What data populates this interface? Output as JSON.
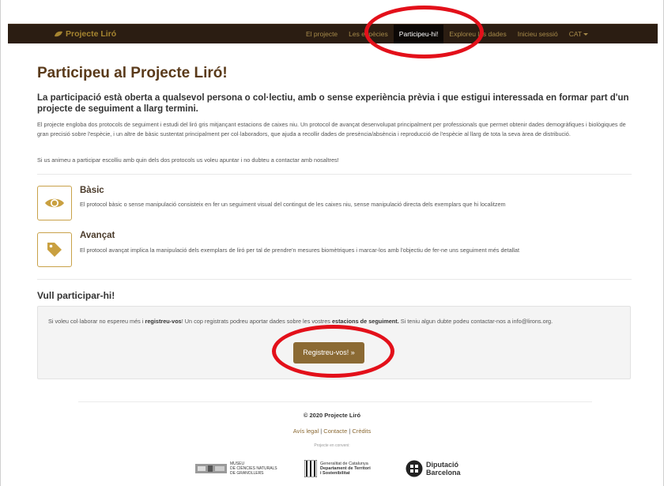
{
  "navbar": {
    "brand": "Projecte Liró",
    "items": [
      {
        "label": "El projecte"
      },
      {
        "label": "Les espècies"
      },
      {
        "label": "Participeu-hi!"
      },
      {
        "label": "Exploreu les dades"
      },
      {
        "label": "Inicieu sessió"
      },
      {
        "label": "CAT"
      }
    ],
    "active_index": 2,
    "colors": {
      "background": "#2b1d12",
      "active": "#0c0806",
      "link": "#a68a4a"
    }
  },
  "main": {
    "title": "Participeu al Projecte Liró!",
    "lead": "La participació està oberta a qualsevol persona o col·lectiu, amb o sense experiència prèvia i que estigui interessada en formar part d'un projecte de seguiment a llarg termini.",
    "paragraph1": "El projecte engloba dos protocols de seguiment i estudi del liró gris mitjançant estacions de caixes niu. Un protocol de avançat desenvolupat principalment per professionals que permet obtenir dades demogràfiques i biològiques de gran precisió sobre l'espècie, i un altre de bàsic sustentat principalment per col·laboradors, que ajuda a recollir dades de presència/absència i reproducció de l'espècie al llarg de tota la seva àrea de distribució.",
    "paragraph2": "Si us animeu a participar escolliu amb quin dels dos protocols us voleu apuntar i no dubteu a contactar amb nosaltres!",
    "protocols": [
      {
        "title": "Bàsic",
        "icon": "eye-icon",
        "text": "El protocol bàsic o sense manipulació consisteix en fer un seguiment visual del contingut de les caixes niu, sense manipulació directa dels exemplars que hi localitzem"
      },
      {
        "title": "Avançat",
        "icon": "tag-icon",
        "text": "El protocol avançat implica la manipulació dels exemplars de liró per tal de prendre'n mesures biomètriques i marcar-los amb l'objectiu de fer-ne uns seguiment més detallat"
      }
    ],
    "join": {
      "heading": "Vull participar-hi!",
      "text_1": "Si voleu col·laborar no espereu més i ",
      "bold_1": "registreu-vos",
      "text_2": "! Un cop registrats podreu aportar dades sobre les vostres ",
      "bold_2": "estacions de seguiment.",
      "text_3": " Si teniu algun dubte podeu contactar-nos a info@lirons.org.",
      "button": "Registreu-vos! »"
    },
    "accent_color": "#8b6a34"
  },
  "footer": {
    "copyright": "© 2020 Projecte Liró",
    "links": [
      "Avís legal",
      "Contacte",
      "Crèdits"
    ],
    "separator": " | ",
    "convenio": "Projecte en conveni:",
    "logos": [
      {
        "name": "museu-logo",
        "lines": [
          "MUSEU",
          "DE CIÈNCIES NATURALS",
          "DE GRANOLLERS"
        ]
      },
      {
        "name": "generalitat-logo",
        "lines": [
          "Generalitat de Catalunya",
          "Departament de Territori",
          "i Sostenibilitat"
        ]
      },
      {
        "name": "diputacio-logo",
        "lines": [
          "Diputació",
          "Barcelona"
        ]
      }
    ]
  }
}
